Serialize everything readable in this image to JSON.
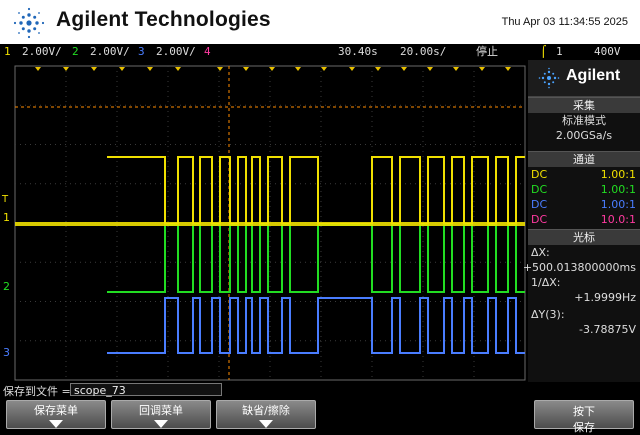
{
  "header": {
    "brand": "Agilent Technologies",
    "datetime": "Thu Apr 03 11:34:55 2025"
  },
  "status": {
    "ch1": {
      "num": "1",
      "scale": "2.00V/",
      "color": "#f0e000"
    },
    "ch2": {
      "num": "2",
      "scale": "2.00V/",
      "color": "#22dd22"
    },
    "ch3": {
      "num": "3",
      "scale": "2.00V/",
      "color": "#4a7dff"
    },
    "ch4": {
      "num": "4",
      "color": "#ff3aa0"
    },
    "time_delay": "30.40s",
    "time_scale": "20.00s/",
    "run_state": "停止",
    "trigger_source": "1",
    "trigger_level": "400V"
  },
  "panel": {
    "brand": "Agilent",
    "acq_title": "采集",
    "acq_mode": "标准模式",
    "acq_rate": "2.00GSa/s",
    "channels_title": "通道",
    "channels": [
      {
        "coupling": "DC",
        "probe": "1.00:1",
        "color": "#f0e000"
      },
      {
        "coupling": "DC",
        "probe": "1.00:1",
        "color": "#22dd22"
      },
      {
        "coupling": "DC",
        "probe": "1.00:1",
        "color": "#4a7dff"
      },
      {
        "coupling": "DC",
        "probe": "10.0:1",
        "color": "#ff3aa0"
      }
    ],
    "cursors_title": "光标",
    "dx_label": "ΔX:",
    "dx_value": "+500.013800000ms",
    "inv_dx_label": "1/ΔX:",
    "inv_dx_value": "+1.9999Hz",
    "dy_label": "ΔY(3):",
    "dy_value": "-3.78875V"
  },
  "save": {
    "label": "保存到文件 =",
    "filename": "scope_73"
  },
  "softkeys": {
    "k1": "保存菜单",
    "k2": "回调菜单",
    "k3": "缺省/擦除",
    "k4_line1": "按下",
    "k4_line2": "保存"
  },
  "markers": {
    "ch1": "1",
    "ch2": "2",
    "ch3": "3",
    "trigger": "T"
  },
  "colors": {
    "ch1": "#f0e000",
    "ch2": "#22dd22",
    "ch3": "#4a7dff",
    "ch4": "#ff3aa0",
    "cursor": "#ff8c00"
  }
}
